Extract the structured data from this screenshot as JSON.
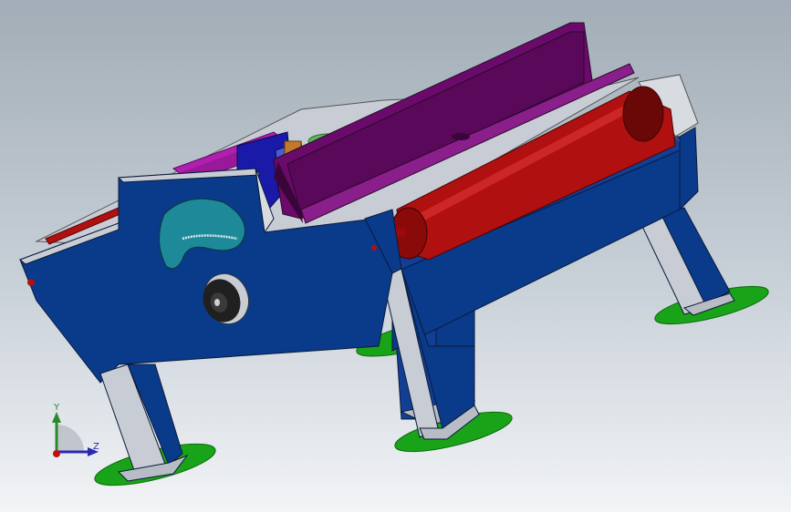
{
  "viewport": {
    "background_top": "#a2adb7",
    "background_bottom": "#f2f4f6"
  },
  "model": {
    "colors": {
      "frame": "#0a3a8a",
      "frame_edge": "#1a4ea6",
      "frame_inner": "#c8ccd4",
      "feet": "#19a319",
      "roller": "#b01010",
      "roller_dark": "#6a0808",
      "guide_plate": "#6a0a6a",
      "guide_plate_light": "#8a1e8a",
      "bracket": "#b020b0",
      "cam_plate": "#1e8a99",
      "knob": "#202020",
      "end_cap": "#d8dce0"
    }
  },
  "triad": {
    "y_label": "Y",
    "z_label": "Z",
    "y_color": "#2a8a2a",
    "z_color": "#2a2ab0",
    "origin_color": "#c01010"
  }
}
